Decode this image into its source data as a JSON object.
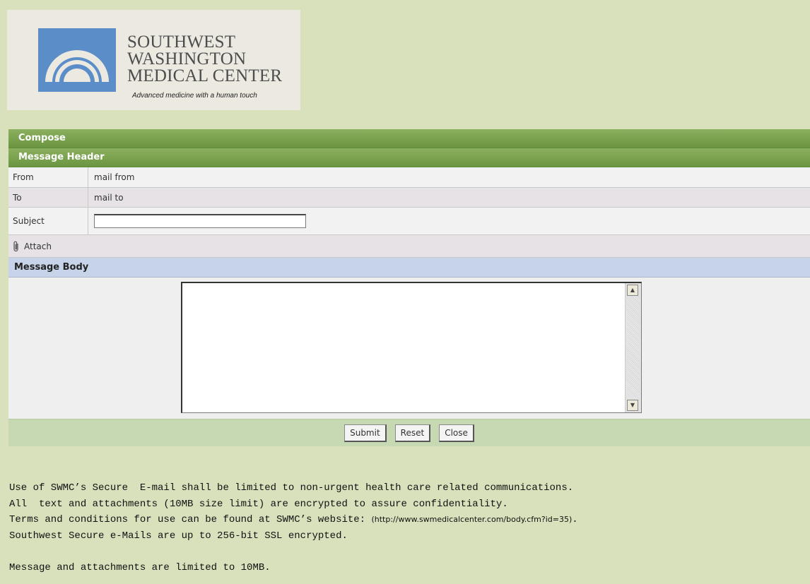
{
  "logo": {
    "line1": "SOUTHWEST",
    "line2": "WASHINGTON",
    "line3": "MEDICAL CENTER",
    "tagline": "Advanced medicine with a human touch"
  },
  "compose": {
    "title": "Compose",
    "header_title": "Message Header",
    "from_label": "From",
    "from_value": "mail from",
    "to_label": "To",
    "to_value": "mail to",
    "subject_label": "Subject",
    "subject_value": "",
    "attach_label": "Attach",
    "body_title": "Message Body",
    "body_value": ""
  },
  "buttons": {
    "submit": "Submit",
    "reset": "Reset",
    "close": "Close"
  },
  "notice": {
    "line1": "Use of SWMC’s Secure  E-mail shall be limited to non-urgent health care related communications.",
    "line2": "All  text and attachments (10MB size limit) are encrypted to assure confidentiality.",
    "line3_prefix": "Terms and conditions for use can be found at SWMC’s website: ",
    "line3_url": "(http://www.swmedicalcenter.com/body.cfm?id=35)",
    "line3_suffix": ".",
    "line4": "Southwest Secure e-Mails are up to 256-bit SSL encrypted.",
    "line5": "Message and attachments are limited to 10MB."
  },
  "colors": {
    "page_bg": "#d8e0bc",
    "green_header": "#7aa34f",
    "blue_header": "#c6d3e8",
    "logo_blue": "#5b8dc8"
  }
}
